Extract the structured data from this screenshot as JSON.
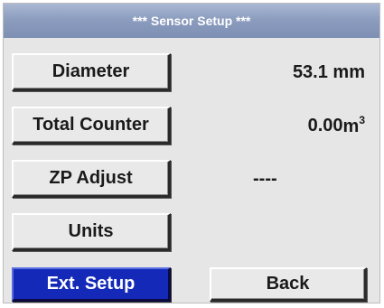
{
  "title": "*** Sensor Setup ***",
  "buttons": {
    "diameter": "Diameter",
    "total_counter": "Total Counter",
    "zp_adjust": "ZP Adjust",
    "units": "Units",
    "ext_setup": "Ext. Setup",
    "back": "Back"
  },
  "values": {
    "diameter": "53.1 mm",
    "total_counter_number": "0.00",
    "total_counter_unit": "m",
    "total_counter_exponent": "3",
    "zp_adjust": "----"
  },
  "colors": {
    "title_bar": "#8c9dbf",
    "active_button": "#1429b8",
    "background": "#e6e6e6"
  }
}
